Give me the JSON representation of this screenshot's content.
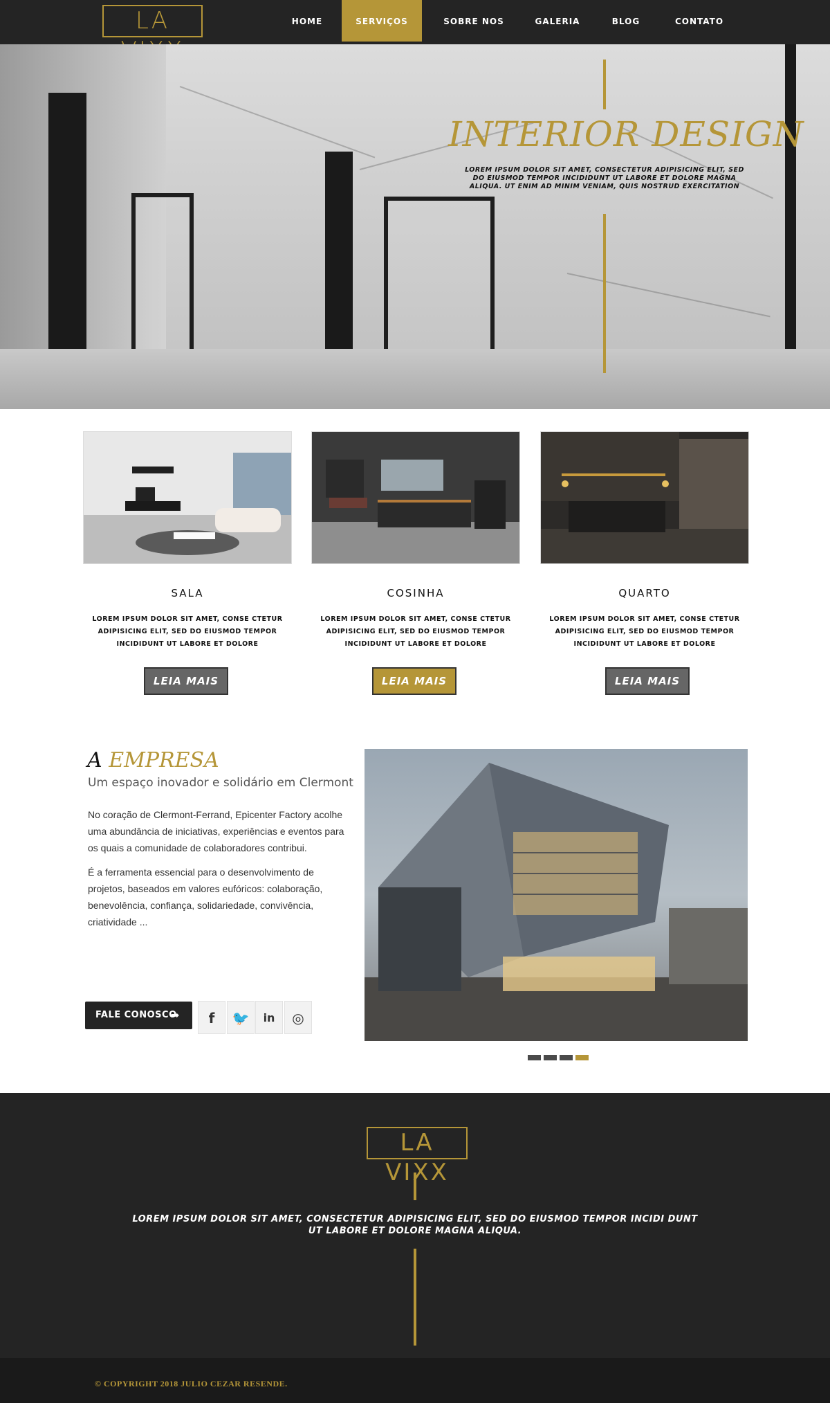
{
  "header": {
    "logo": "LA VIXX",
    "nav": [
      {
        "label": "HOME",
        "active": false
      },
      {
        "label": "SERVIÇOS",
        "active": true
      },
      {
        "label": "SOBRE NOS",
        "active": false
      },
      {
        "label": "GALERIA",
        "active": false
      },
      {
        "label": "BLOG",
        "active": false
      },
      {
        "label": "CONTATO",
        "active": false
      }
    ]
  },
  "hero": {
    "title": "INTERIOR DESIGN",
    "subtitle": "LOREM IPSUM DOLOR SIT AMET, CONSECTETUR ADIPISICING ELIT, SED DO EIUSMOD TEMPOR INCIDIDUNT UT LABORE ET DOLORE MAGNA ALIQUA. UT ENIM AD MINIM VENIAM, QUIS NOSTRUD EXERCITATION"
  },
  "services": [
    {
      "title": "SALA",
      "desc": "LOREM IPSUM DOLOR SIT AMET, CONSE CTETUR ADIPISICING ELIT, SED DO EIUSMOD TEMPOR INCIDIDUNT UT LABORE ET DOLORE",
      "button": "LEIA MAIS",
      "button_color": "#666666"
    },
    {
      "title": "COSINHA",
      "desc": "LOREM IPSUM DOLOR SIT AMET, CONSE CTETUR ADIPISICING ELIT, SED DO EIUSMOD TEMPOR INCIDIDUNT UT LABORE ET DOLORE",
      "button": "LEIA MAIS",
      "button_color": "#b59638"
    },
    {
      "title": "QUARTO",
      "desc": "LOREM IPSUM DOLOR SIT AMET, CONSE CTETUR ADIPISICING ELIT, SED DO EIUSMOD TEMPOR INCIDIDUNT UT LABORE ET DOLORE",
      "button": "LEIA MAIS",
      "button_color": "#666666"
    }
  ],
  "empresa": {
    "title_a": "A",
    "title_b": "EMPRESA",
    "subtitle": "Um espaço inovador e solidário em Clermont",
    "p1": "No coração de Clermont-Ferrand, Epicenter Factory acolhe uma abundância de iniciativas, experiências e eventos para os quais a comunidade de colaboradores contribui.",
    "p2": "É a ferramenta essencial para o desenvolvimento de projetos, baseados em valores eufóricos: colaboração, benevolência, confiança, solidariedade, convivência, criatividade ...",
    "cta": "FALE CONOSCO",
    "social": [
      {
        "icon": "facebook-icon",
        "glyph": "f"
      },
      {
        "icon": "twitter-icon",
        "glyph": "🐦"
      },
      {
        "icon": "linkedin-icon",
        "glyph": "in"
      },
      {
        "icon": "instagram-icon",
        "glyph": "◎"
      }
    ],
    "slider_total": 4,
    "slider_active": 4
  },
  "footer": {
    "logo": "LA VIXX",
    "text": "LOREM IPSUM DOLOR SIT AMET, CONSECTETUR ADIPISICING ELIT, SED DO EIUSMOD TEMPOR INCIDI DUNT UT LABORE ET DOLORE MAGNA ALIQUA.",
    "copyright": "© COPYRIGHT 2018 JULIO CEZAR RESENDE."
  },
  "colors": {
    "accent": "#b59638",
    "dark": "#242424"
  }
}
